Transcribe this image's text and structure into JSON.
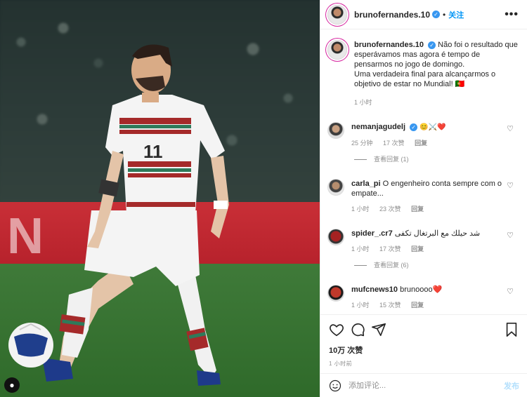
{
  "post": {
    "author": "brunofernandes.10",
    "follow_label": "关注",
    "more_icon": "•••",
    "caption_author": "brunofernandes.10",
    "caption_text": "Não foi o resultado que esperávamos mas agora é tempo de pensarmos no jogo de domingo.\nUma verdadeira final para alcançarmos o objetivo de estar no Mundial! 🇵🇹",
    "caption_time": "1 小时"
  },
  "photo": {
    "board_text": "N",
    "jersey_number": "11"
  },
  "comments": [
    {
      "user": "nemanjagudelj",
      "verified": true,
      "text": "😊⚔️❤️",
      "time": "25 分钟",
      "likes": "17 次赞",
      "reply": "回复",
      "view_replies": "查看回复 (1)"
    },
    {
      "user": "carla_pi",
      "verified": false,
      "text": "O engenheiro conta sempre com o empate...",
      "time": "1 小时",
      "likes": "23 次赞",
      "reply": "回复",
      "view_replies": ""
    },
    {
      "user": "spider_.cr7",
      "verified": false,
      "text": "شد حيلك مع البرتغال تكفى",
      "time": "1 小时",
      "likes": "17 次赞",
      "reply": "回复",
      "view_replies": "查看回复 (6)"
    },
    {
      "user": "mufcnews10",
      "verified": false,
      "text": "brunoooo❤️",
      "time": "1 小时",
      "likes": "15 次赞",
      "reply": "回复",
      "view_replies": ""
    }
  ],
  "actions": {
    "likes": "10万 次赞",
    "time": "1 小时前"
  },
  "add_comment": {
    "placeholder": "添加评论...",
    "post_label": "发布"
  }
}
